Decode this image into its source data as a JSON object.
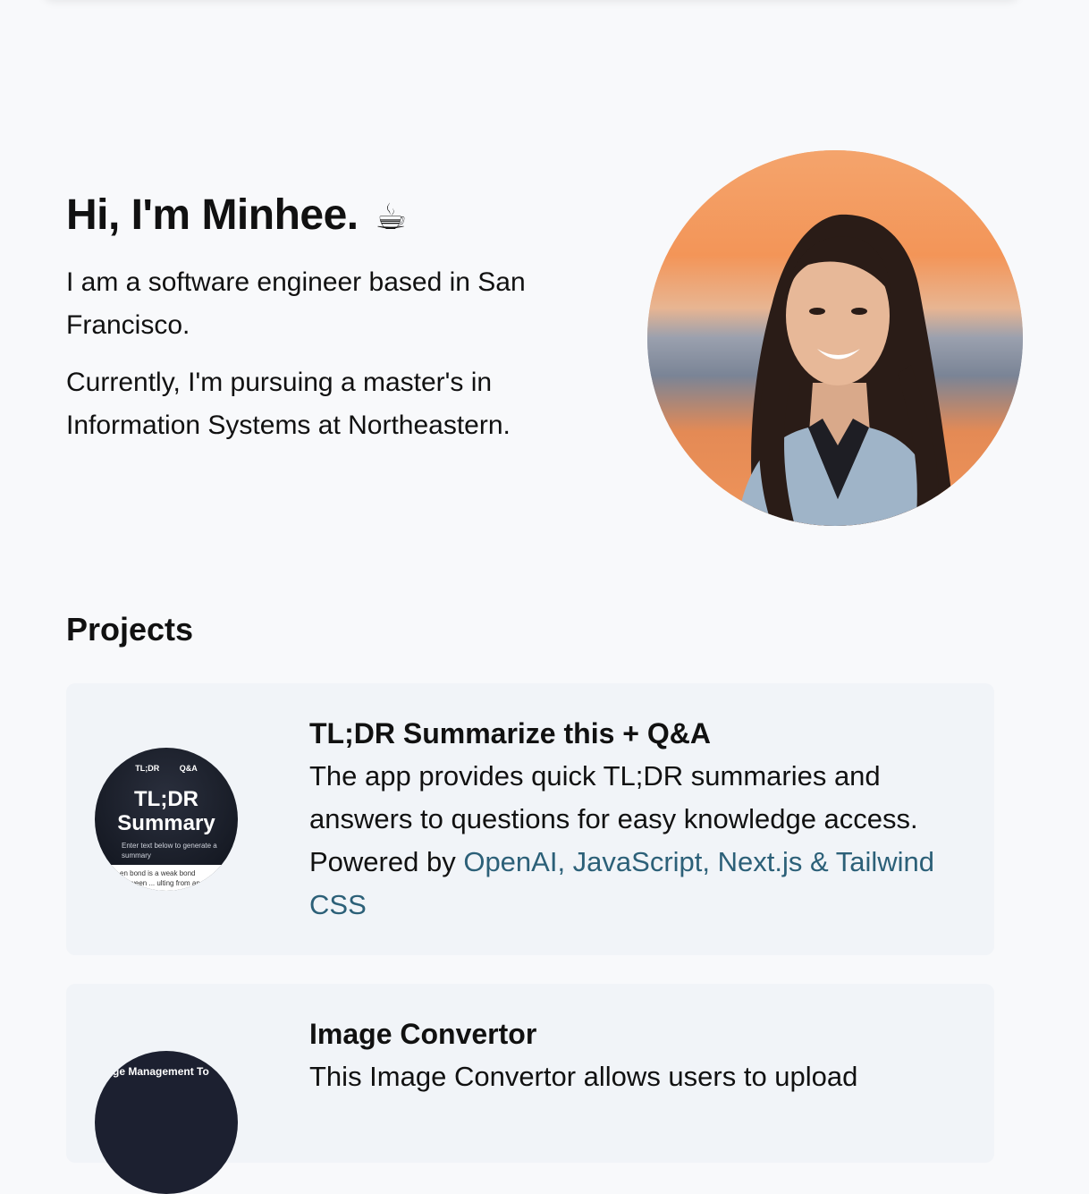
{
  "hero": {
    "title": "Hi, I'm Minhee.",
    "emoji": "☕",
    "intro": "I am a software engineer based in San Francisco.",
    "current": "Currently, I'm pursuing a master's in Information Systems at Northeastern."
  },
  "projects": {
    "heading": "Projects",
    "items": [
      {
        "title": "TL;DR Summarize this + Q&A",
        "description": "The app provides quick TL;DR summaries and answers to questions for easy knowledge access. Powered by ",
        "tech": "OpenAI, JavaScript, Next.js & Tailwind CSS",
        "thumb": {
          "nav_left": "TL;DR",
          "nav_right": "Q&A",
          "headline_1": "TL;DR",
          "headline_2": "Summary",
          "hint": "Enter text below to generate a summary",
          "sample": "en bond is a weak bond between ... ulting from an electros"
        }
      },
      {
        "title": "Image Convertor",
        "description": "This Image Convertor allows users to upload",
        "thumb": {
          "label": "nage Management To"
        }
      }
    ]
  },
  "colors": {
    "background": "#f8f9fb",
    "card": "#f1f4f8",
    "tech_link": "#2c6078"
  }
}
